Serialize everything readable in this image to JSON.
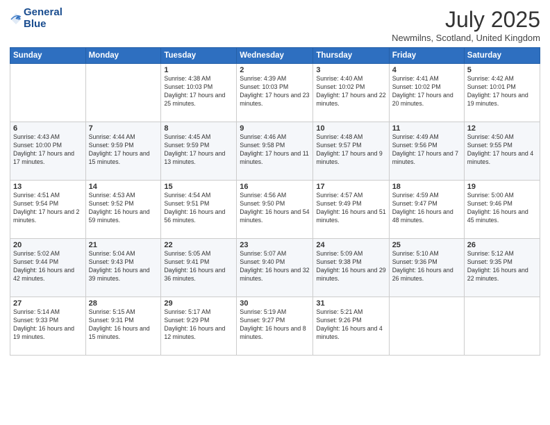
{
  "header": {
    "logo_line1": "General",
    "logo_line2": "Blue",
    "month_title": "July 2025",
    "subtitle": "Newmilns, Scotland, United Kingdom"
  },
  "days_of_week": [
    "Sunday",
    "Monday",
    "Tuesday",
    "Wednesday",
    "Thursday",
    "Friday",
    "Saturday"
  ],
  "weeks": [
    [
      {
        "day": "",
        "info": ""
      },
      {
        "day": "",
        "info": ""
      },
      {
        "day": "1",
        "info": "Sunrise: 4:38 AM\nSunset: 10:03 PM\nDaylight: 17 hours and 25 minutes."
      },
      {
        "day": "2",
        "info": "Sunrise: 4:39 AM\nSunset: 10:03 PM\nDaylight: 17 hours and 23 minutes."
      },
      {
        "day": "3",
        "info": "Sunrise: 4:40 AM\nSunset: 10:02 PM\nDaylight: 17 hours and 22 minutes."
      },
      {
        "day": "4",
        "info": "Sunrise: 4:41 AM\nSunset: 10:02 PM\nDaylight: 17 hours and 20 minutes."
      },
      {
        "day": "5",
        "info": "Sunrise: 4:42 AM\nSunset: 10:01 PM\nDaylight: 17 hours and 19 minutes."
      }
    ],
    [
      {
        "day": "6",
        "info": "Sunrise: 4:43 AM\nSunset: 10:00 PM\nDaylight: 17 hours and 17 minutes."
      },
      {
        "day": "7",
        "info": "Sunrise: 4:44 AM\nSunset: 9:59 PM\nDaylight: 17 hours and 15 minutes."
      },
      {
        "day": "8",
        "info": "Sunrise: 4:45 AM\nSunset: 9:59 PM\nDaylight: 17 hours and 13 minutes."
      },
      {
        "day": "9",
        "info": "Sunrise: 4:46 AM\nSunset: 9:58 PM\nDaylight: 17 hours and 11 minutes."
      },
      {
        "day": "10",
        "info": "Sunrise: 4:48 AM\nSunset: 9:57 PM\nDaylight: 17 hours and 9 minutes."
      },
      {
        "day": "11",
        "info": "Sunrise: 4:49 AM\nSunset: 9:56 PM\nDaylight: 17 hours and 7 minutes."
      },
      {
        "day": "12",
        "info": "Sunrise: 4:50 AM\nSunset: 9:55 PM\nDaylight: 17 hours and 4 minutes."
      }
    ],
    [
      {
        "day": "13",
        "info": "Sunrise: 4:51 AM\nSunset: 9:54 PM\nDaylight: 17 hours and 2 minutes."
      },
      {
        "day": "14",
        "info": "Sunrise: 4:53 AM\nSunset: 9:52 PM\nDaylight: 16 hours and 59 minutes."
      },
      {
        "day": "15",
        "info": "Sunrise: 4:54 AM\nSunset: 9:51 PM\nDaylight: 16 hours and 56 minutes."
      },
      {
        "day": "16",
        "info": "Sunrise: 4:56 AM\nSunset: 9:50 PM\nDaylight: 16 hours and 54 minutes."
      },
      {
        "day": "17",
        "info": "Sunrise: 4:57 AM\nSunset: 9:49 PM\nDaylight: 16 hours and 51 minutes."
      },
      {
        "day": "18",
        "info": "Sunrise: 4:59 AM\nSunset: 9:47 PM\nDaylight: 16 hours and 48 minutes."
      },
      {
        "day": "19",
        "info": "Sunrise: 5:00 AM\nSunset: 9:46 PM\nDaylight: 16 hours and 45 minutes."
      }
    ],
    [
      {
        "day": "20",
        "info": "Sunrise: 5:02 AM\nSunset: 9:44 PM\nDaylight: 16 hours and 42 minutes."
      },
      {
        "day": "21",
        "info": "Sunrise: 5:04 AM\nSunset: 9:43 PM\nDaylight: 16 hours and 39 minutes."
      },
      {
        "day": "22",
        "info": "Sunrise: 5:05 AM\nSunset: 9:41 PM\nDaylight: 16 hours and 36 minutes."
      },
      {
        "day": "23",
        "info": "Sunrise: 5:07 AM\nSunset: 9:40 PM\nDaylight: 16 hours and 32 minutes."
      },
      {
        "day": "24",
        "info": "Sunrise: 5:09 AM\nSunset: 9:38 PM\nDaylight: 16 hours and 29 minutes."
      },
      {
        "day": "25",
        "info": "Sunrise: 5:10 AM\nSunset: 9:36 PM\nDaylight: 16 hours and 26 minutes."
      },
      {
        "day": "26",
        "info": "Sunrise: 5:12 AM\nSunset: 9:35 PM\nDaylight: 16 hours and 22 minutes."
      }
    ],
    [
      {
        "day": "27",
        "info": "Sunrise: 5:14 AM\nSunset: 9:33 PM\nDaylight: 16 hours and 19 minutes."
      },
      {
        "day": "28",
        "info": "Sunrise: 5:15 AM\nSunset: 9:31 PM\nDaylight: 16 hours and 15 minutes."
      },
      {
        "day": "29",
        "info": "Sunrise: 5:17 AM\nSunset: 9:29 PM\nDaylight: 16 hours and 12 minutes."
      },
      {
        "day": "30",
        "info": "Sunrise: 5:19 AM\nSunset: 9:27 PM\nDaylight: 16 hours and 8 minutes."
      },
      {
        "day": "31",
        "info": "Sunrise: 5:21 AM\nSunset: 9:26 PM\nDaylight: 16 hours and 4 minutes."
      },
      {
        "day": "",
        "info": ""
      },
      {
        "day": "",
        "info": ""
      }
    ]
  ]
}
